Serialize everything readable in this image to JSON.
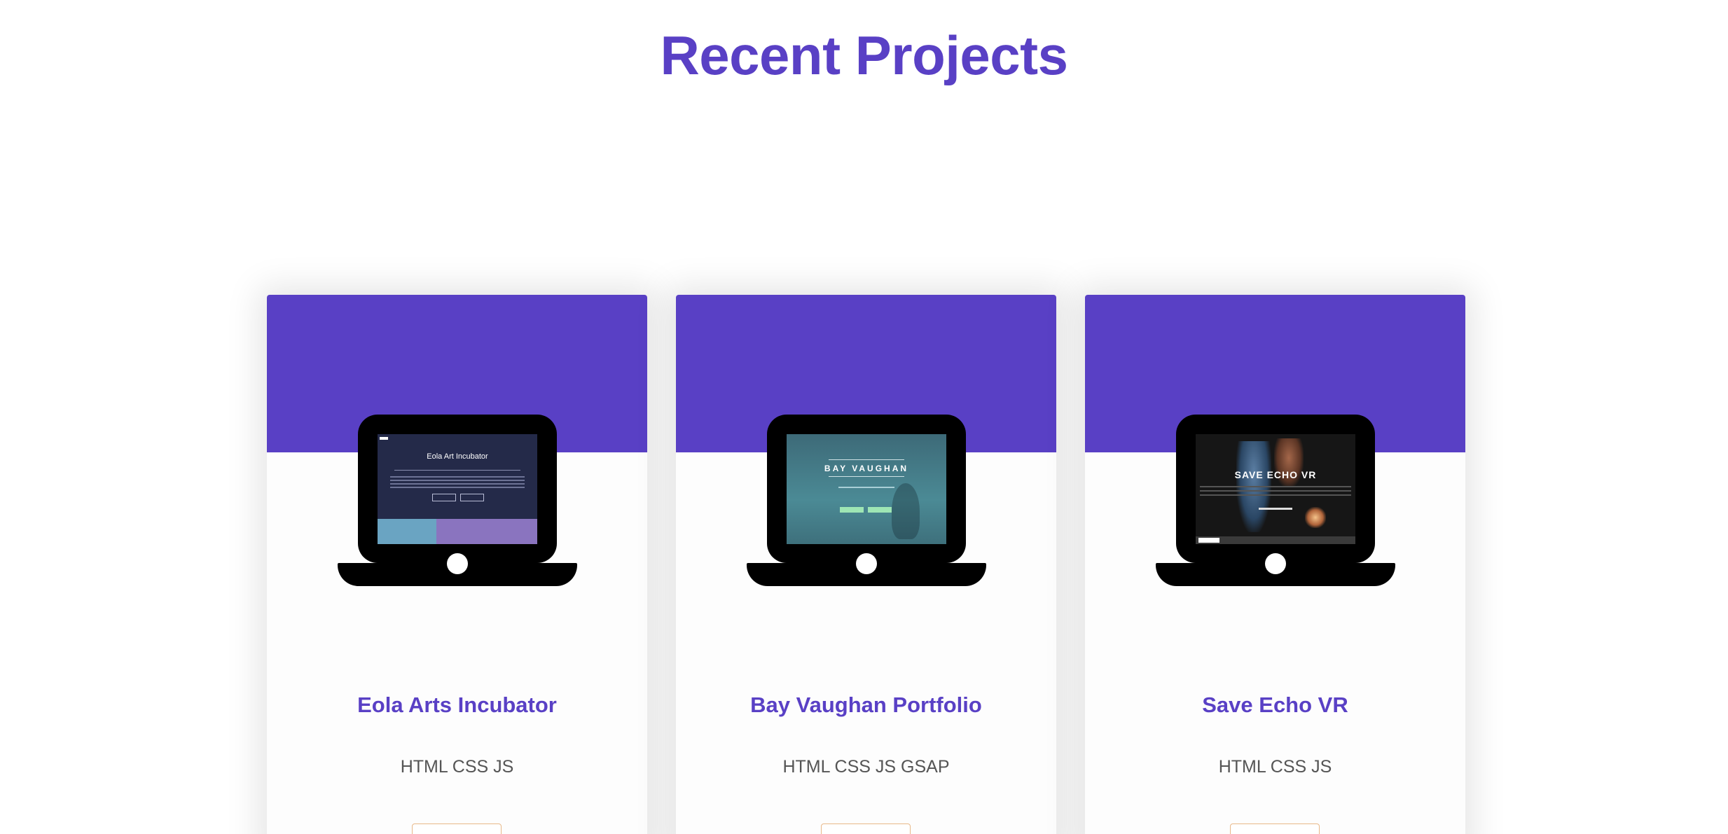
{
  "section": {
    "title": "Recent Projects"
  },
  "projects": [
    {
      "name": "Eola Arts Incubator",
      "tech": "HTML CSS JS",
      "screenshot_title": "Eola Art Incubator"
    },
    {
      "name": "Bay Vaughan Portfolio",
      "tech": "HTML CSS JS GSAP",
      "screenshot_title": "BAY VAUGHAN"
    },
    {
      "name": "Save Echo VR",
      "tech": "HTML CSS JS",
      "screenshot_title": "SAVE ECHO VR"
    }
  ],
  "colors": {
    "accent": "#5940c5",
    "button_border": "#e8b888",
    "text_muted": "#555555"
  }
}
